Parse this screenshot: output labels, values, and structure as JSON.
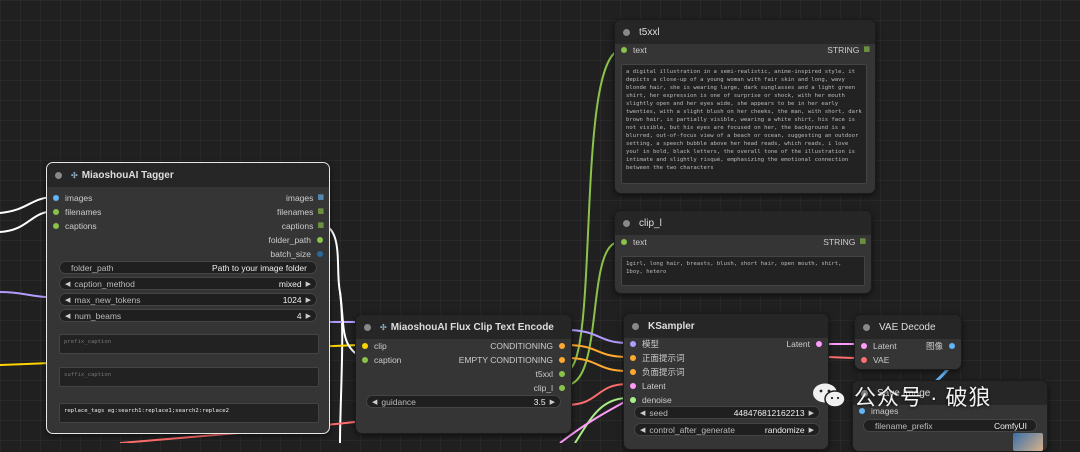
{
  "tagger": {
    "title": "MiaoshouAI Tagger",
    "inputs": [
      "images",
      "filenames",
      "captions"
    ],
    "outputs": [
      "images",
      "filenames",
      "captions",
      "folder_path",
      "batch_size"
    ],
    "folder_path_label": "folder_path",
    "folder_path_value": "Path to your image folder",
    "caption_method_label": "caption_method",
    "caption_method_value": "mixed",
    "max_new_tokens_label": "max_new_tokens",
    "max_new_tokens_value": "1024",
    "num_beams_label": "num_beams",
    "num_beams_value": "4",
    "prefix_caption": "prefix_caption",
    "suffix_caption": "suffix_caption",
    "replace_tags": "replace_tags eg:search1:replace1;search2:replace2"
  },
  "encoder": {
    "title": "MiaoshouAI Flux Clip Text Encode",
    "inputs": [
      "clip",
      "caption"
    ],
    "outputs": [
      "CONDITIONING",
      "EMPTY CONDITIONING",
      "t5xxl",
      "clip_l"
    ],
    "guidance_label": "guidance",
    "guidance_value": "3.5"
  },
  "t5xxl": {
    "title": "t5xxl",
    "input": "text",
    "output": "STRING",
    "text": "a digital illustration in a semi-realistic, anime-inspired style, it depicts a close-up of a young woman with fair skin and long, wavy blonde hair, she is wearing large, dark sunglasses and a light green shirt, her expression is one of surprise or shock, with her mouth slightly open and her eyes wide, she appears to be in her early twenties, with a slight blush on her cheeks, the man, with short, dark brown hair, is partially visible, wearing a white shirt, his face is not visible, but his eyes are focused on her, the background is a blurred, out-of-focus view of a beach or ocean, suggesting an outdoor setting, a speech bubble above her head reads, which reads, i love you! in bold, black letters, the overall tone of the illustration is intimate and slightly risqué, emphasizing the emotional connection between the two characters"
  },
  "clip_l": {
    "title": "clip_l",
    "input": "text",
    "output": "STRING",
    "text": "1girl, long hair, breasts, blush, short hair, open mouth, shirt, 1boy, hetero"
  },
  "ksampler": {
    "title": "KSampler",
    "inputs": [
      "模型",
      "正面提示词",
      "负面提示词",
      "Latent",
      "denoise"
    ],
    "output": "Latent",
    "seed_label": "seed",
    "seed_value": "448476812162213",
    "control_label": "control_after_generate",
    "control_value": "randomize"
  },
  "vae_decode": {
    "title": "VAE Decode",
    "inputs": [
      "Latent",
      "VAE"
    ],
    "output": "图像"
  },
  "save_image": {
    "title": "Save Image",
    "input": "images",
    "filename_label": "filename_prefix",
    "filename_value": "ComfyUI"
  },
  "watermark": "公众号 · 破狼",
  "colors": {
    "image": "#64b5f6",
    "string": "#6ca32d",
    "conditioning": "#ffa931",
    "latent": "#ff9cf9",
    "clip": "#ffd500",
    "vae": "#ff6e6e",
    "float": "#aaee88",
    "int": "#29699c"
  }
}
